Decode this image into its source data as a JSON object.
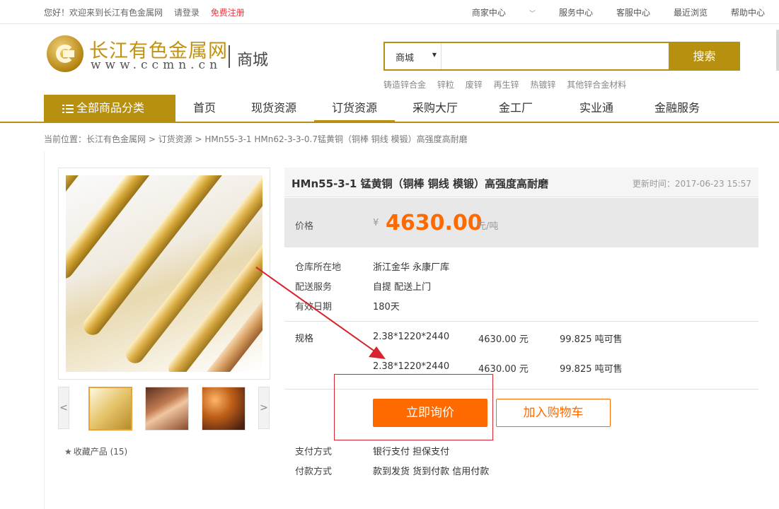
{
  "topbar": {
    "greeting": "您好！欢迎来到长江有色金属网",
    "login": "请登录",
    "register": "免费注册",
    "links": [
      "商家中心",
      "服务中心",
      "客服中心",
      "最近浏览",
      "帮助中心"
    ]
  },
  "header": {
    "logo_cn": "长江有色金属网",
    "logo_url": "www.ccmn.cn",
    "mall": "商城",
    "search": {
      "category": "商城",
      "placeholder": "",
      "button": "搜索"
    },
    "hotwords": [
      "铸造锌合金",
      "锌粒",
      "废锌",
      "再生锌",
      "热镀锌",
      "其他锌合金材料"
    ]
  },
  "nav": {
    "all_categories": "全部商品分类",
    "items": [
      "首页",
      "现货资源",
      "订货资源",
      "采购大厅",
      "金工厂",
      "实业通",
      "金融服务"
    ],
    "active_index": 2
  },
  "breadcrumb": "当前位置：长江有色金属网 > 订货资源 > HMn55-3-1 HMn62-3-3-0.7锰黄铜（铜棒 铜线 模锻）高强度高耐磨",
  "gallery": {
    "prev": "<",
    "next": ">",
    "favorite": "收藏产品 (15)"
  },
  "product": {
    "title": "HMn55-3-1 锰黄铜（铜棒 铜线 模锻）高强度高耐磨",
    "updated": "更新时间：2017-06-23 15:57",
    "price_label": "价格",
    "currency": "¥",
    "price": "4630.00",
    "unit": "元/吨",
    "info": [
      {
        "k": "仓库所在地",
        "v": "浙江金华 永康厂库"
      },
      {
        "k": "配送服务",
        "v": "自提 配送上门"
      },
      {
        "k": "有效日期",
        "v": "180天"
      }
    ],
    "spec_label": "规格",
    "specs": [
      {
        "size": "2.38*1220*2440",
        "price": "4630.00 元",
        "stock": "99.825 吨可售"
      },
      {
        "size": "2.38*1220*2440",
        "price": "4630.00 元",
        "stock": "99.825 吨可售"
      }
    ],
    "inquiry_button": "立即询价",
    "cart_button": "加入购物车",
    "payment": [
      {
        "k": "支付方式",
        "v": "银行支付 担保支付"
      },
      {
        "k": "付款方式",
        "v": "款到发货 货到付款 信用付款"
      }
    ]
  },
  "colors": {
    "brand": "#b8900f",
    "accent": "#ff6a00",
    "annotation": "#d9232e"
  }
}
